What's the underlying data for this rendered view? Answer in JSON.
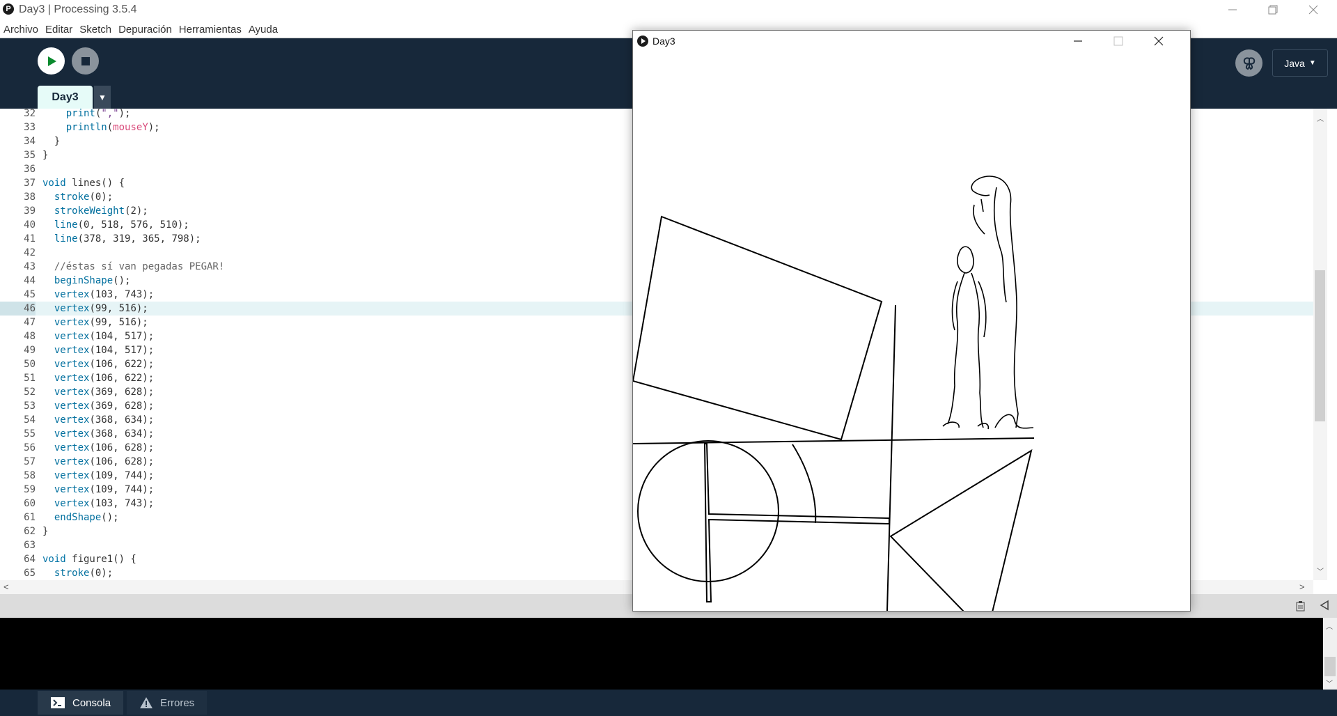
{
  "window": {
    "title": "Day3 | Processing 3.5.4",
    "logo_glyph": "P",
    "controls": [
      "minimize",
      "restore",
      "close"
    ]
  },
  "menu": [
    "Archivo",
    "Editar",
    "Sketch",
    "Depuración",
    "Herramientas",
    "Ayuda"
  ],
  "toolbar": {
    "run_icon": "play-icon",
    "stop_icon": "stop-icon",
    "debug_icon": "butterfly-icon",
    "mode_label": "Java"
  },
  "tabs": [
    {
      "label": "Day3",
      "active": true
    }
  ],
  "editor": {
    "current_line": 46,
    "lines": [
      {
        "n": "32",
        "code": "    print(\",\");"
      },
      {
        "n": "33",
        "code": "    println(mouseY);"
      },
      {
        "n": "34",
        "code": "  }"
      },
      {
        "n": "35",
        "code": "}"
      },
      {
        "n": "36",
        "code": ""
      },
      {
        "n": "37",
        "code": "void lines() {"
      },
      {
        "n": "38",
        "code": "  stroke(0);"
      },
      {
        "n": "39",
        "code": "  strokeWeight(2);"
      },
      {
        "n": "40",
        "code": "  line(0, 518, 576, 510);"
      },
      {
        "n": "41",
        "code": "  line(378, 319, 365, 798);"
      },
      {
        "n": "42",
        "code": ""
      },
      {
        "n": "43",
        "code": "  //éstas sí van pegadas PEGAR!"
      },
      {
        "n": "44",
        "code": "  beginShape();"
      },
      {
        "n": "45",
        "code": "  vertex(103, 743);"
      },
      {
        "n": "46",
        "code": "  vertex(99, 516);"
      },
      {
        "n": "47",
        "code": "  vertex(99, 516);"
      },
      {
        "n": "48",
        "code": "  vertex(104, 517);"
      },
      {
        "n": "49",
        "code": "  vertex(104, 517);"
      },
      {
        "n": "50",
        "code": "  vertex(106, 622);"
      },
      {
        "n": "51",
        "code": "  vertex(106, 622);"
      },
      {
        "n": "52",
        "code": "  vertex(369, 628);"
      },
      {
        "n": "53",
        "code": "  vertex(369, 628);"
      },
      {
        "n": "54",
        "code": "  vertex(368, 634);"
      },
      {
        "n": "55",
        "code": "  vertex(368, 634);"
      },
      {
        "n": "56",
        "code": "  vertex(106, 628);"
      },
      {
        "n": "57",
        "code": "  vertex(106, 628);"
      },
      {
        "n": "58",
        "code": "  vertex(109, 744);"
      },
      {
        "n": "59",
        "code": "  vertex(109, 744);"
      },
      {
        "n": "60",
        "code": "  vertex(103, 743);"
      },
      {
        "n": "61",
        "code": "  endShape();"
      },
      {
        "n": "62",
        "code": "}"
      },
      {
        "n": "63",
        "code": ""
      },
      {
        "n": "64",
        "code": "void figure1() {"
      },
      {
        "n": "65",
        "code": "  stroke(0);"
      }
    ]
  },
  "console_tabs": [
    {
      "label": "Consola",
      "icon": "terminal-icon"
    },
    {
      "label": "Errores",
      "icon": "warning-icon"
    }
  ],
  "sketch_window": {
    "title": "Day3",
    "controls": [
      "minimize",
      "maximize",
      "close"
    ]
  }
}
